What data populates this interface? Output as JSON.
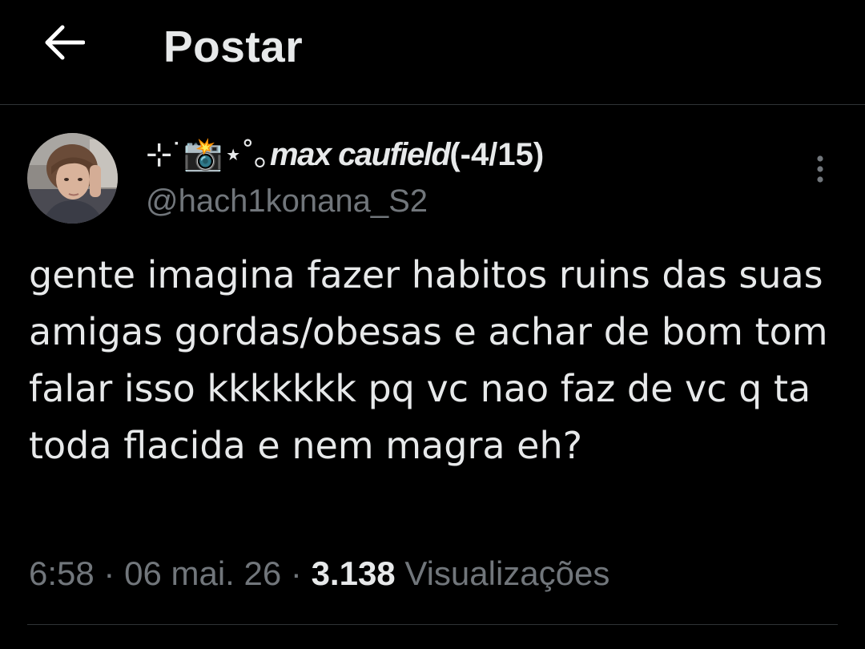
{
  "header": {
    "back_icon": "arrow-left-icon",
    "title": "Postar"
  },
  "post": {
    "author": {
      "display_prefix": "⊹˙📸⋆˚｡",
      "display_name": "max caufield",
      "display_suffix": "(-4/15)",
      "handle": "@hach1konana_S2",
      "avatar_icon": "avatar-photo"
    },
    "more_icon": "more-vertical-icon",
    "text": "gente imagina fazer habitos ruins das suas amigas gordas/obesas e achar de bom tom falar isso kkkkkkk pq vc nao faz de vc q ta toda flacida e nem magra eh?",
    "time": "6:58",
    "separator": "·",
    "date": "06 mai. 26",
    "views_count": "3.138",
    "views_label": "Visualizações"
  },
  "colors": {
    "background": "#000000",
    "text_primary": "#e7e9ea",
    "text_secondary": "#71767b",
    "divider": "#2f3336"
  }
}
